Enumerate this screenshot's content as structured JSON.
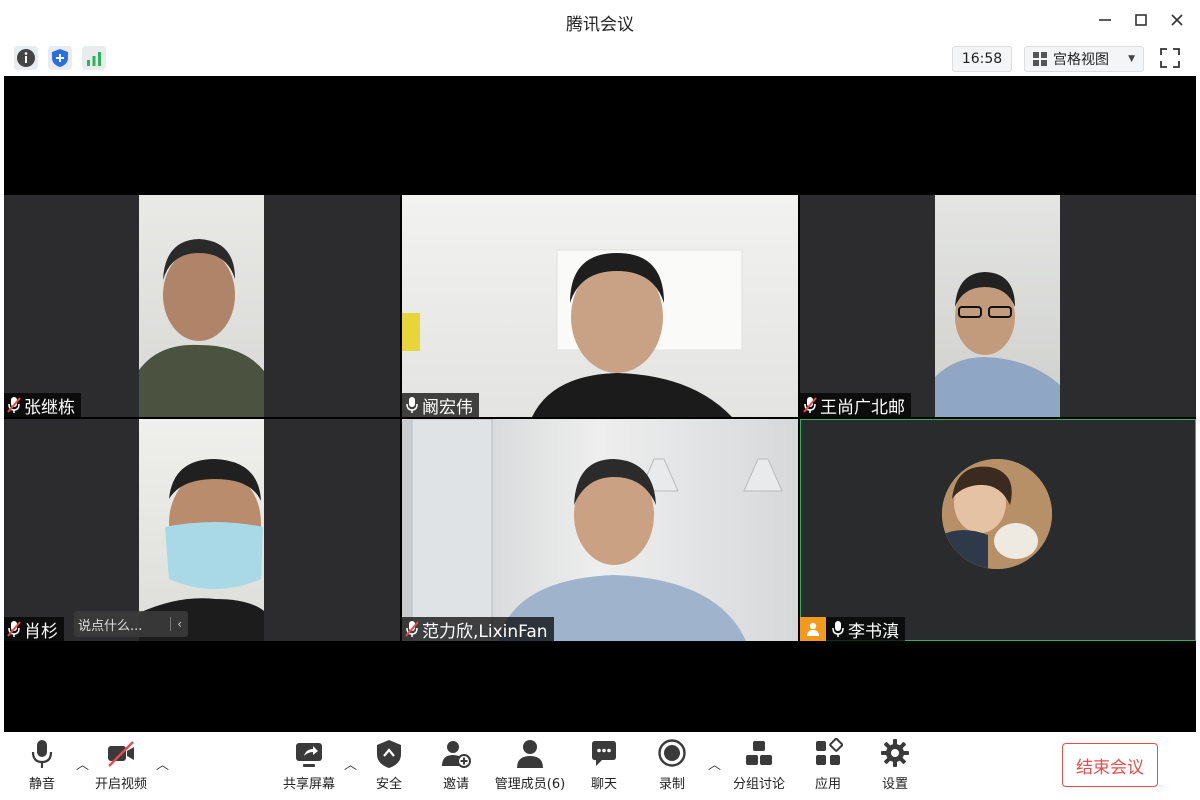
{
  "window": {
    "title": "腾讯会议"
  },
  "toolbar": {
    "time": "16:58",
    "view_label": "宫格视图"
  },
  "participants": [
    {
      "name": "张继栋",
      "muted": true
    },
    {
      "name": "阚宏伟",
      "muted": false
    },
    {
      "name": "王尚广北邮",
      "muted": true
    },
    {
      "name": "肖杉",
      "muted": true
    },
    {
      "name": "范力欣,LixinFan",
      "muted": true
    },
    {
      "name": "李书滇",
      "muted": false,
      "video_off": true,
      "active_speaker": true
    }
  ],
  "chat_input": {
    "placeholder": "说点什么..."
  },
  "controls": {
    "mute": "静音",
    "video": "开启视频",
    "share": "共享屏幕",
    "security": "安全",
    "invite": "邀请",
    "members": "管理成员(6)",
    "chat": "聊天",
    "record": "录制",
    "breakout": "分组讨论",
    "apps": "应用",
    "settings": "设置",
    "end": "结束会议"
  },
  "colors": {
    "accent_green": "#2fb35a",
    "end_red": "#e34d4d",
    "badge_orange": "#f39a1e"
  }
}
